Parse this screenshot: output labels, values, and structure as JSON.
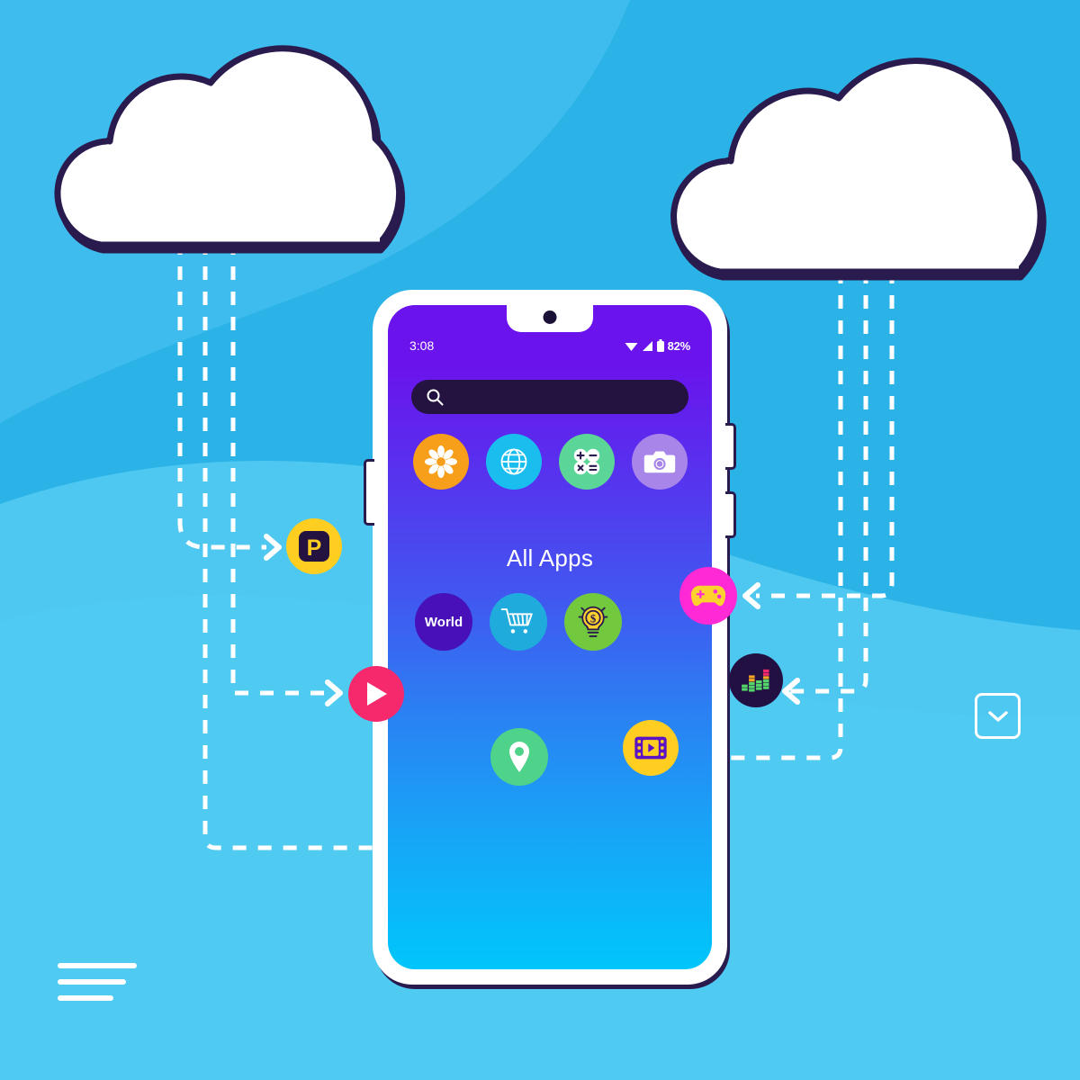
{
  "scene": {
    "title": "Cloud app sync illustration",
    "background_color": "#2BB3E8",
    "background_accent_color": "#4EC8F0",
    "background_dark_color": "#0FA3E0",
    "outline_color": "#2A1B4E",
    "dash_color": "#FFFFFF"
  },
  "clouds": [
    {
      "name": "left-cloud",
      "fill": "#FFFFFF",
      "stroke": "#2A1B4E",
      "streams": 3
    },
    {
      "name": "right-cloud",
      "fill": "#FFFFFF",
      "stroke": "#2A1B4E",
      "streams": 3
    }
  ],
  "phone": {
    "frame_color": "#FFFFFF",
    "frame_shadow_color": "#2A1B4E",
    "screen_gradient_top": "#6A13EC",
    "screen_gradient_bottom": "#00C6FB",
    "status_bar": {
      "time": "3:08",
      "battery_percent": "82%",
      "icons": [
        "wifi-icon",
        "signal-icon",
        "battery-icon"
      ]
    },
    "search": {
      "icon": "search-icon",
      "value": "",
      "placeholder": "",
      "background": "#241340"
    },
    "dock_apps": [
      {
        "name": "settings",
        "icon": "flower-gear-icon",
        "bg": "#F79E1B",
        "fg": "#FFFFFF"
      },
      {
        "name": "browser",
        "icon": "globe-icon",
        "bg": "#19BEEF",
        "fg": "#FFFFFF"
      },
      {
        "name": "calculator",
        "icon": "calculator-icon",
        "bg": "#5BD598",
        "fg": "#FFFFFF"
      },
      {
        "name": "camera",
        "icon": "camera-icon",
        "bg": "#A885E8",
        "fg": "#FFFFFF"
      }
    ],
    "section_title": "All Apps",
    "grid_apps": [
      {
        "name": "world",
        "icon": "text-label",
        "label": "World",
        "bg": "#4710B8",
        "fg": "#FFFFFF"
      },
      {
        "name": "shopping",
        "icon": "shopping-cart-icon",
        "bg": "#1FACDC",
        "fg": "#FFFFFF"
      },
      {
        "name": "finance",
        "icon": "lightbulb-dollar-icon",
        "bg": "#73C93E",
        "fg": "#FFD12E"
      }
    ],
    "pin_app": {
      "name": "maps",
      "icon": "map-pin-icon",
      "bg": "#4FD28A",
      "fg": "#FFFFFF"
    },
    "side_buttons": [
      "power-button",
      "volume-up-button",
      "volume-down-button"
    ]
  },
  "floating_apps": [
    {
      "name": "parking",
      "icon": "letter-p-icon",
      "bg": "#FFCE21",
      "fg": "#241340",
      "side": "left"
    },
    {
      "name": "video-player",
      "icon": "play-icon",
      "bg": "#F5296B",
      "fg": "#FFFFFF",
      "side": "left"
    },
    {
      "name": "games",
      "icon": "gamepad-icon",
      "bg": "#FF29D6",
      "fg": "#FFD12E",
      "side": "right"
    },
    {
      "name": "music",
      "icon": "equalizer-icon",
      "bg": "#231042",
      "fg": "#7ED957",
      "side": "right"
    },
    {
      "name": "movies",
      "icon": "film-play-icon",
      "bg": "#FFCE21",
      "fg": "#5B13C4",
      "side": "right"
    }
  ],
  "decorations": {
    "line_widths": [
      88,
      76,
      62
    ],
    "chevron_box": {
      "icon": "chevron-down-icon",
      "color": "#FFFFFF"
    }
  }
}
